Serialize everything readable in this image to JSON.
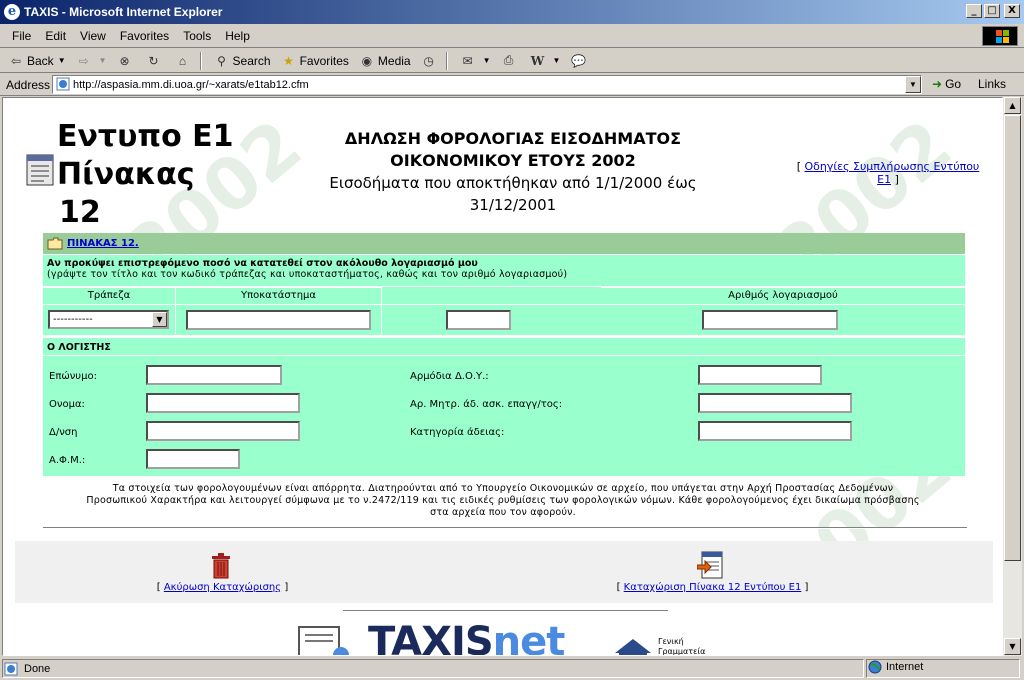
{
  "window": {
    "title": "TAXIS - Microsoft Internet Explorer",
    "min": "_",
    "max": "□",
    "close": "X"
  },
  "menu": [
    "File",
    "Edit",
    "View",
    "Favorites",
    "Tools",
    "Help"
  ],
  "toolbar": {
    "back": "Back",
    "search": "Search",
    "favorites": "Favorites",
    "media": "Media"
  },
  "address": {
    "label": "Address",
    "url": "http://aspasia.mm.di.uoa.gr/~xarats/e1tab12.cfm",
    "go": "Go",
    "links": "Links"
  },
  "page": {
    "form_title_1": "Εντυπο Ε1",
    "form_title_2": "Πίνακας",
    "form_title_3": "12",
    "head_1": "ΔΗΛΩΣΗ ΦΟΡΟΛΟΓΙΑΣ ΕΙΣΟΔΗΜΑΤΟΣ",
    "head_2": "ΟΙΚΟΝΟΜΙΚΟΥ ΕΤΟΥΣ 2002",
    "head_3": "Εισοδήματα που αποκτήθηκαν από 1/1/2000 έως",
    "head_4": "31/12/2001",
    "guide_open": "[",
    "guide_link": "Οδηγίες Συμπλήρωσης Εντύπου Ε1",
    "guide_close": "]"
  },
  "table12": {
    "header_link": "ΠΙΝΑΚΑΣ 12.",
    "note_bold": "Αν προκύψει επιστρεφόμενο ποσό να κατατεθεί στον ακόλουθο λογαριασμό μου",
    "note_hint": "(γράψτε τον τίτλο και τον κωδικό τράπεζας και υποκαταστήματος, καθώς και τον αριθμό λογαριασμού)",
    "col_bank": "Τράπεζα",
    "col_branch": "Υποκατάστημα",
    "col_account": "Αριθμός λογαριασμού",
    "bank_selected": "-----------"
  },
  "accountant": {
    "title": "Ο ΛΟΓΙΣΤΗΣ",
    "surname": "Επώνυμο:",
    "name": "Ονομα:",
    "address": "Δ/νση",
    "afm": "Α.Φ.Μ.:",
    "doy": "Αρμόδια Δ.Ο.Υ.:",
    "license_no": "Αρ. Μητρ. άδ. ασκ. επαγγ/τος:",
    "license_cat": "Κατηγορία άδειας:"
  },
  "privacy": {
    "line1": "Τα στοιχεία των φορολογουμένων είναι απόρρητα. Διατηρούνται από το Υπουργείο Οικονομικών σε αρχείο, που υπάγεται στην Αρχή Προστασίας Δεδομένων",
    "line2": "Προσωπικού Χαρακτήρα και λειτουργεί σύμφωνα με το ν.2472/119 και τις ειδικές ρυθμίσεις των φορολογικών νόμων. Κάθε φορολογούμενος έχει δικαίωμα πρόσβασης",
    "line3": "στα αρχεία που τον αφορούν."
  },
  "actions": {
    "cancel": "Ακύρωση Καταχώρισης",
    "submit": "Καταχώριση Πίνακα 12 Εντύπου Ε1",
    "open": "[",
    "close": "]"
  },
  "logo": {
    "text_a": "TAXIS",
    "text_b": "net",
    "side_1": "Γενική",
    "side_2": "Γραμματεία"
  },
  "status": {
    "text": "Done",
    "zone": "Internet"
  }
}
